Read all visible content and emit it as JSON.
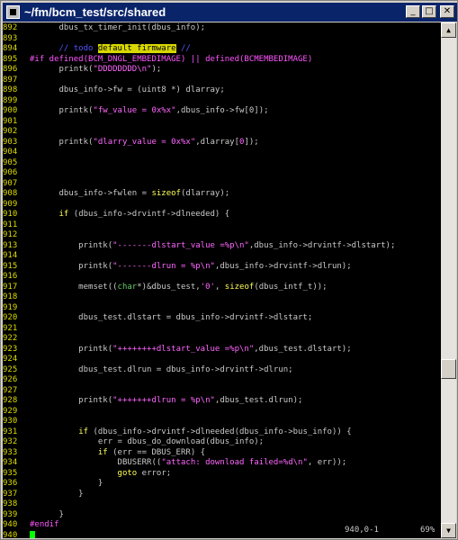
{
  "window": {
    "title": "~/fm/bcm_test/src/shared",
    "minimize_label": "_",
    "maximize_label": "□",
    "close_label": "✕"
  },
  "scrollbar": {
    "up_arrow": "▲",
    "down_arrow": "▼",
    "position_fraction": 0.69
  },
  "editor": {
    "lines": [
      {
        "n": "892",
        "segs": [
          {
            "t": "      dbus_tx_timer_init(dbus_info);",
            "c": ""
          }
        ]
      },
      {
        "n": "893",
        "segs": []
      },
      {
        "n": "894",
        "segs": [
          {
            "t": "      // todo ",
            "c": "cm"
          },
          {
            "t": "default firmware",
            "c": "hl"
          },
          {
            "t": " //",
            "c": "cm"
          }
        ]
      },
      {
        "n": "895",
        "segs": [
          {
            "t": "#if defined(BCM_DNGL_EMBEDIMAGE) || defined(BCMEMBEDIMAGE)",
            "c": "pp"
          }
        ]
      },
      {
        "n": "896",
        "segs": [
          {
            "t": "      printk(",
            "c": ""
          },
          {
            "t": "\"DDDDDDDD\\n\"",
            "c": "str"
          },
          {
            "t": ");",
            "c": ""
          }
        ]
      },
      {
        "n": "897",
        "segs": []
      },
      {
        "n": "898",
        "segs": [
          {
            "t": "      dbus_info->fw = (uint8 *) dlarray;",
            "c": ""
          }
        ]
      },
      {
        "n": "899",
        "segs": []
      },
      {
        "n": "900",
        "segs": [
          {
            "t": "      printk(",
            "c": ""
          },
          {
            "t": "\"fw_value = 0x%x\"",
            "c": "str"
          },
          {
            "t": ",dbus_info->fw[0]);",
            "c": ""
          }
        ]
      },
      {
        "n": "901",
        "segs": []
      },
      {
        "n": "902",
        "segs": []
      },
      {
        "n": "903",
        "segs": [
          {
            "t": "      printk(",
            "c": ""
          },
          {
            "t": "\"dlarry_value = 0x%x\"",
            "c": "str"
          },
          {
            "t": ",dlarray[",
            "c": ""
          },
          {
            "t": "0",
            "c": "str"
          },
          {
            "t": "]);",
            "c": ""
          }
        ]
      },
      {
        "n": "904",
        "segs": []
      },
      {
        "n": "905",
        "segs": []
      },
      {
        "n": "906",
        "segs": []
      },
      {
        "n": "907",
        "segs": []
      },
      {
        "n": "908",
        "segs": [
          {
            "t": "      dbus_info->fwlen = ",
            "c": ""
          },
          {
            "t": "sizeof",
            "c": "kw"
          },
          {
            "t": "(dlarray);",
            "c": ""
          }
        ]
      },
      {
        "n": "909",
        "segs": []
      },
      {
        "n": "910",
        "segs": [
          {
            "t": "      ",
            "c": ""
          },
          {
            "t": "if",
            "c": "kw"
          },
          {
            "t": " (dbus_info->drvintf->dlneeded) {",
            "c": ""
          }
        ]
      },
      {
        "n": "911",
        "segs": []
      },
      {
        "n": "912",
        "segs": []
      },
      {
        "n": "913",
        "segs": [
          {
            "t": "          printk(",
            "c": ""
          },
          {
            "t": "\"-------dlstart_value =%p\\n\"",
            "c": "str"
          },
          {
            "t": ",dbus_info->drvintf->dlstart);",
            "c": ""
          }
        ]
      },
      {
        "n": "914",
        "segs": []
      },
      {
        "n": "915",
        "segs": [
          {
            "t": "          printk(",
            "c": ""
          },
          {
            "t": "\"-------dlrun = %p\\n\"",
            "c": "str"
          },
          {
            "t": ",dbus_info->drvintf->dlrun);",
            "c": ""
          }
        ]
      },
      {
        "n": "916",
        "segs": []
      },
      {
        "n": "917",
        "segs": [
          {
            "t": "          memset((",
            "c": ""
          },
          {
            "t": "char",
            "c": "ty"
          },
          {
            "t": "*)&dbus_test,",
            "c": ""
          },
          {
            "t": "'0'",
            "c": "str"
          },
          {
            "t": ", ",
            "c": ""
          },
          {
            "t": "sizeof",
            "c": "kw"
          },
          {
            "t": "(dbus_intf_t));",
            "c": ""
          }
        ]
      },
      {
        "n": "918",
        "segs": []
      },
      {
        "n": "919",
        "segs": []
      },
      {
        "n": "920",
        "segs": [
          {
            "t": "          dbus_test.dlstart = dbus_info->drvintf->dlstart;",
            "c": ""
          }
        ]
      },
      {
        "n": "921",
        "segs": []
      },
      {
        "n": "922",
        "segs": []
      },
      {
        "n": "923",
        "segs": [
          {
            "t": "          printk(",
            "c": ""
          },
          {
            "t": "\"++++++++dlstart_value =%p\\n\"",
            "c": "str"
          },
          {
            "t": ",dbus_test.dlstart);",
            "c": ""
          }
        ]
      },
      {
        "n": "924",
        "segs": []
      },
      {
        "n": "925",
        "segs": [
          {
            "t": "          dbus_test.dlrun = dbus_info->drvintf->dlrun;",
            "c": ""
          }
        ]
      },
      {
        "n": "926",
        "segs": []
      },
      {
        "n": "927",
        "segs": []
      },
      {
        "n": "928",
        "segs": [
          {
            "t": "          printk(",
            "c": ""
          },
          {
            "t": "\"+++++++dlrun = %p\\n\"",
            "c": "str"
          },
          {
            "t": ",dbus_test.dlrun);",
            "c": ""
          }
        ]
      },
      {
        "n": "929",
        "segs": []
      },
      {
        "n": "930",
        "segs": []
      },
      {
        "n": "931",
        "segs": [
          {
            "t": "          ",
            "c": ""
          },
          {
            "t": "if",
            "c": "kw"
          },
          {
            "t": " (dbus_info->drvintf->dlneeded(dbus_info->bus_info)) {",
            "c": ""
          }
        ]
      },
      {
        "n": "932",
        "segs": [
          {
            "t": "              err = dbus_do_download(dbus_info);",
            "c": ""
          }
        ]
      },
      {
        "n": "933",
        "segs": [
          {
            "t": "              ",
            "c": ""
          },
          {
            "t": "if",
            "c": "kw"
          },
          {
            "t": " (err == DBUS_ERR) {",
            "c": ""
          }
        ]
      },
      {
        "n": "934",
        "segs": [
          {
            "t": "                  DBUSERR((",
            "c": ""
          },
          {
            "t": "\"attach: download failed=%d\\n\"",
            "c": "str"
          },
          {
            "t": ", err));",
            "c": ""
          }
        ]
      },
      {
        "n": "935",
        "segs": [
          {
            "t": "                  ",
            "c": ""
          },
          {
            "t": "goto",
            "c": "kw"
          },
          {
            "t": " error;",
            "c": ""
          }
        ]
      },
      {
        "n": "936",
        "segs": [
          {
            "t": "              }",
            "c": ""
          }
        ]
      },
      {
        "n": "937",
        "segs": [
          {
            "t": "          }",
            "c": ""
          }
        ]
      },
      {
        "n": "938",
        "segs": []
      },
      {
        "n": "939",
        "segs": [
          {
            "t": "      }",
            "c": ""
          }
        ]
      },
      {
        "n": "940",
        "segs": [
          {
            "t": "#endif",
            "c": "pp"
          }
        ]
      },
      {
        "n": "940",
        "segs": [],
        "cursor": true
      }
    ]
  },
  "status": {
    "position": "940,0-1",
    "percent": "69%"
  }
}
